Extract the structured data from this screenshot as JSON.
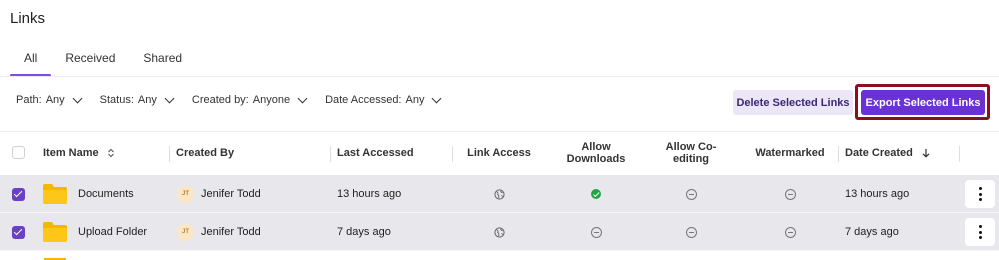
{
  "page": {
    "title": "Links"
  },
  "tabs": [
    {
      "label": "All",
      "active": true
    },
    {
      "label": "Received",
      "active": false
    },
    {
      "label": "Shared",
      "active": false
    }
  ],
  "filters": [
    {
      "label": "Path:",
      "value": "Any"
    },
    {
      "label": "Status:",
      "value": "Any"
    },
    {
      "label": "Created by:",
      "value": "Anyone"
    },
    {
      "label": "Date Accessed:",
      "value": "Any"
    }
  ],
  "actions": {
    "delete_label": "Delete Selected Links",
    "export_label": "Export Selected Links"
  },
  "table": {
    "columns": {
      "item_name": "Item Name",
      "created_by": "Created By",
      "last_accessed": "Last Accessed",
      "link_access": "Link Access",
      "allow_downloads": "Allow Downloads",
      "allow_coediting": "Allow Co-editing",
      "watermarked": "Watermarked",
      "date_created": "Date Created"
    },
    "rows": [
      {
        "selected": true,
        "name": "Documents",
        "creator_initials": "JT",
        "creator": "Jenifer Todd",
        "last_accessed": "13 hours ago",
        "link_access": "globe-icon",
        "allow_downloads": "check-circle-icon",
        "allow_coediting": "minus-circle-icon",
        "watermarked": "minus-circle-icon",
        "date_created": "13 hours ago"
      },
      {
        "selected": true,
        "name": "Upload Folder",
        "creator_initials": "JT",
        "creator": "Jenifer Todd",
        "last_accessed": "7 days ago",
        "link_access": "globe-icon",
        "allow_downloads": "minus-circle-icon",
        "allow_coediting": "minus-circle-icon",
        "watermarked": "minus-circle-icon",
        "date_created": "7 days ago"
      }
    ]
  },
  "colors": {
    "accent": "#6a32d6",
    "highlight_outline": "#8b0f20",
    "selected_row": "#e7e7ec",
    "folder": "#f5b800",
    "success": "#22a447"
  }
}
